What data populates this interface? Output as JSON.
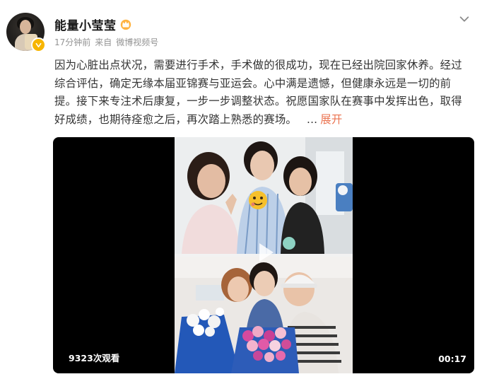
{
  "post": {
    "author": {
      "name": "能量小莹莹",
      "verified": true,
      "badge_color": "#f7b500",
      "crown_icon": "crown-icon"
    },
    "meta": {
      "time": "17分钟前",
      "source_prefix": "来自",
      "source": "微博视频号"
    },
    "content": {
      "text": "因为心脏出点状况，需要进行手术，手术做的很成功，现在已经出院回家休养。经过综合评估，确定无缘本届亚锦赛与亚运会。心中满是遗憾，但健康永远是一切的前提。接下来专注术后康复，一步一步调整状态。祝愿国家队在赛事中发挥出色，取得好成绩，也期待痊愈之后，再次踏上熟悉的赛场。",
      "ellipsis": "...",
      "expand_label": "展开",
      "expand_color": "#eb7350"
    },
    "video": {
      "views": "9323次观看",
      "duration": "00:17"
    }
  }
}
